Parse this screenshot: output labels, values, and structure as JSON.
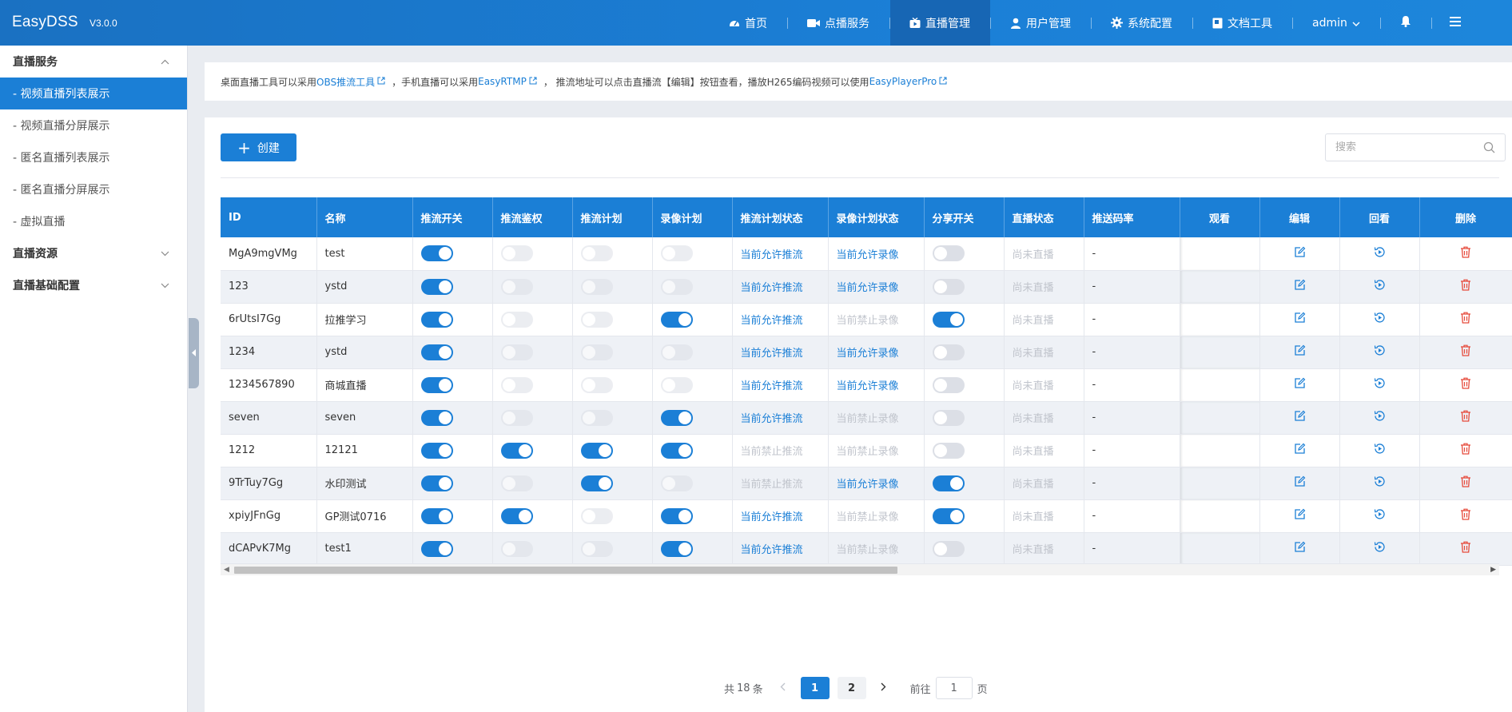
{
  "app": {
    "name": "EasyDSS",
    "version": "V3.0.0"
  },
  "nav": {
    "items": [
      {
        "label": "首页",
        "icon": "dashboard-icon"
      },
      {
        "label": "点播服务",
        "icon": "video-camera-icon"
      },
      {
        "label": "直播管理",
        "icon": "live-icon",
        "active": true
      },
      {
        "label": "用户管理",
        "icon": "user-icon"
      },
      {
        "label": "系统配置",
        "icon": "gear-icon"
      },
      {
        "label": "文档工具",
        "icon": "book-icon"
      }
    ],
    "user": "admin"
  },
  "sidebar": {
    "group1": "直播服务",
    "items": [
      "- 视频直播列表展示",
      "- 视频直播分屏展示",
      "- 匿名直播列表展示",
      "- 匿名直播分屏展示",
      "- 虚拟直播"
    ],
    "group2": "直播资源",
    "group3": "直播基础配置"
  },
  "info": {
    "t1": "桌面直播工具可以采用 ",
    "l1": "OBS推流工具",
    "t2": "，手机直播可以采用 ",
    "l2": "EasyRTMP",
    "t3": "， 推流地址可以点击直播流【编辑】按钮查看，播放H265编码视频可以使用 ",
    "l3": "EasyPlayerPro"
  },
  "toolbar": {
    "create_label": "创建",
    "search_placeholder": "搜索"
  },
  "table": {
    "headers": [
      "ID",
      "名称",
      "推流开关",
      "推流鉴权",
      "推流计划",
      "录像计划",
      "推流计划状态",
      "录像计划状态",
      "分享开关",
      "直播状态",
      "推送码率",
      "观看",
      "编辑",
      "回看",
      "删除"
    ],
    "rows": [
      {
        "id": "MgA9mgVMg",
        "name": "test",
        "push": true,
        "auth": false,
        "plan": false,
        "rec": false,
        "push_status": "当前允许推流",
        "rec_status": "当前允许录像",
        "share": false,
        "live": "尚未直播",
        "bitrate": "-"
      },
      {
        "id": "123",
        "name": "ystd",
        "push": true,
        "auth": false,
        "plan": false,
        "rec": false,
        "push_status": "当前允许推流",
        "rec_status": "当前允许录像",
        "share": false,
        "live": "尚未直播",
        "bitrate": "-"
      },
      {
        "id": "6rUtsI7Gg",
        "name": "拉推学习",
        "push": true,
        "auth": false,
        "plan": false,
        "rec": true,
        "push_status": "当前允许推流",
        "rec_status": "当前禁止录像",
        "share": true,
        "live": "尚未直播",
        "bitrate": "-"
      },
      {
        "id": "1234",
        "name": "ystd",
        "push": true,
        "auth": false,
        "plan": false,
        "rec": false,
        "push_status": "当前允许推流",
        "rec_status": "当前允许录像",
        "share": false,
        "live": "尚未直播",
        "bitrate": "-"
      },
      {
        "id": "1234567890",
        "name": "商城直播",
        "push": true,
        "auth": false,
        "plan": false,
        "rec": false,
        "push_status": "当前允许推流",
        "rec_status": "当前允许录像",
        "share": false,
        "live": "尚未直播",
        "bitrate": "-"
      },
      {
        "id": "seven",
        "name": "seven",
        "push": true,
        "auth": false,
        "plan": false,
        "rec": true,
        "push_status": "当前允许推流",
        "rec_status": "当前禁止录像",
        "share": false,
        "live": "尚未直播",
        "bitrate": "-"
      },
      {
        "id": "1212",
        "name": "12121",
        "push": true,
        "auth": true,
        "plan": true,
        "rec": true,
        "push_status": "当前禁止推流",
        "rec_status": "当前禁止录像",
        "share": false,
        "live": "尚未直播",
        "bitrate": "-"
      },
      {
        "id": "9TrTuy7Gg",
        "name": "水印测试",
        "push": true,
        "auth": false,
        "plan": true,
        "rec": false,
        "push_status": "当前禁止推流",
        "rec_status": "当前允许录像",
        "share": true,
        "live": "尚未直播",
        "bitrate": "-"
      },
      {
        "id": "xpiyJFnGg",
        "name": "GP测试0716",
        "push": true,
        "auth": true,
        "plan": false,
        "rec": true,
        "push_status": "当前允许推流",
        "rec_status": "当前禁止录像",
        "share": true,
        "live": "尚未直播",
        "bitrate": "-"
      },
      {
        "id": "dCAPvK7Mg",
        "name": "test1",
        "push": true,
        "auth": false,
        "plan": false,
        "rec": true,
        "push_status": "当前允许推流",
        "rec_status": "当前禁止录像",
        "share": false,
        "live": "尚未直播",
        "bitrate": "-"
      }
    ]
  },
  "pagination": {
    "total_prefix": "共",
    "total": "18",
    "total_suffix": "条",
    "pages": [
      "1",
      "2"
    ],
    "current": "1",
    "goto_prefix": "前往",
    "goto_value": "1",
    "goto_suffix": "页"
  },
  "colors": {
    "primary": "#1b7fd6",
    "header": "#1a71c2",
    "delete": "#e64a3b",
    "muted": "#c0c4cc"
  }
}
